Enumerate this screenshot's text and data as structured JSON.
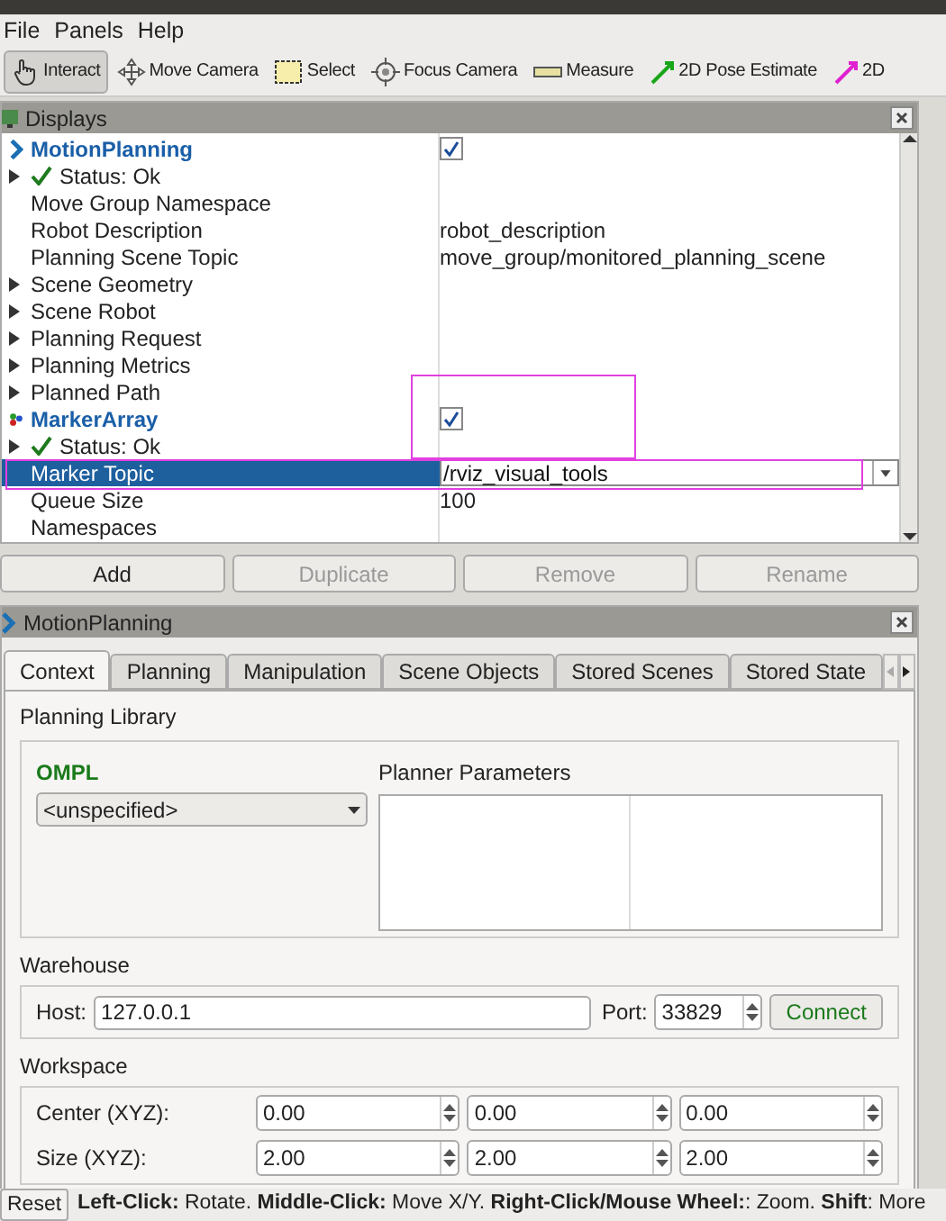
{
  "menu": [
    "File",
    "Panels",
    "Help"
  ],
  "toolbar": [
    {
      "label": "Interact",
      "selected": true,
      "kind": "hand"
    },
    {
      "label": "Move Camera",
      "selected": false,
      "kind": "move"
    },
    {
      "label": "Select",
      "selected": false,
      "kind": "select"
    },
    {
      "label": "Focus Camera",
      "selected": false,
      "kind": "focus"
    },
    {
      "label": "Measure",
      "selected": false,
      "kind": "measure"
    },
    {
      "label": "2D Pose Estimate",
      "selected": false,
      "kind": "pose_green"
    },
    {
      "label": "2D",
      "selected": false,
      "kind": "pose_magenta"
    }
  ],
  "displays": {
    "title": "Displays",
    "rows": [
      {
        "kind": "display",
        "label": "MotionPlanning",
        "checked": true,
        "selected": false
      },
      {
        "kind": "status",
        "label": "Status: Ok",
        "expanded": false,
        "selected": false
      },
      {
        "kind": "property",
        "label": "Move Group Namespace",
        "selected": false
      },
      {
        "kind": "property",
        "label": "Robot Description",
        "value": "robot_description",
        "selected": false
      },
      {
        "kind": "property",
        "label": "Planning Scene Topic",
        "value": "move_group/monitored_planning_scene",
        "selected": false
      },
      {
        "kind": "property",
        "label": "Scene Geometry",
        "expanded": false,
        "selected": false
      },
      {
        "kind": "property",
        "label": "Scene Robot",
        "expanded": false,
        "selected": false
      },
      {
        "kind": "property",
        "label": "Planning Request",
        "expanded": false,
        "selected": false
      },
      {
        "kind": "property",
        "label": "Planning Metrics",
        "expanded": false,
        "selected": false
      },
      {
        "kind": "property",
        "label": "Planned Path",
        "expanded": false,
        "selected": false
      },
      {
        "kind": "display",
        "label": "MarkerArray",
        "checked": true,
        "selected": false
      },
      {
        "kind": "status",
        "label": "Status: Ok",
        "expanded": false,
        "selected": false
      },
      {
        "kind": "property",
        "label": "Marker Topic",
        "value": "/rviz_visual_tools",
        "editing": true,
        "selected": true
      },
      {
        "kind": "property",
        "label": "Queue Size",
        "value": "100",
        "selected": false
      },
      {
        "kind": "property",
        "label": "Namespaces",
        "selected": false
      }
    ],
    "buttons": [
      {
        "label": "Add",
        "disabled": false
      },
      {
        "label": "Duplicate",
        "disabled": true
      },
      {
        "label": "Remove",
        "disabled": true
      },
      {
        "label": "Rename",
        "disabled": true
      }
    ]
  },
  "motion_planning": {
    "title": "MotionPlanning",
    "tabs": [
      {
        "label": "Context",
        "selected": true
      },
      {
        "label": "Planning",
        "selected": false
      },
      {
        "label": "Manipulation",
        "selected": false
      },
      {
        "label": "Scene Objects",
        "selected": false
      },
      {
        "label": "Stored Scenes",
        "selected": false
      },
      {
        "label": "Stored State",
        "selected": false
      }
    ],
    "planning_library": {
      "title": "Planning Library",
      "library": "OMPL",
      "planner": "<unspecified>",
      "parameters_title": "Planner Parameters"
    },
    "warehouse": {
      "title": "Warehouse",
      "host_label": "Host:",
      "host": "127.0.0.1",
      "port_label": "Port:",
      "port": "33829",
      "connect": "Connect"
    },
    "workspace": {
      "title": "Workspace",
      "rows": [
        {
          "label": "Center (XYZ):",
          "values": [
            "0.00",
            "0.00",
            "0.00"
          ]
        },
        {
          "label": "Size (XYZ):",
          "values": [
            "2.00",
            "2.00",
            "2.00"
          ]
        }
      ]
    }
  },
  "status_bar": {
    "reset": "Reset",
    "hint": "**Left-Click:** Rotate. **Middle-Click:** Move X/Y. **Right-Click/Mouse Wheel:**: Zoom. **Shift**: More"
  }
}
